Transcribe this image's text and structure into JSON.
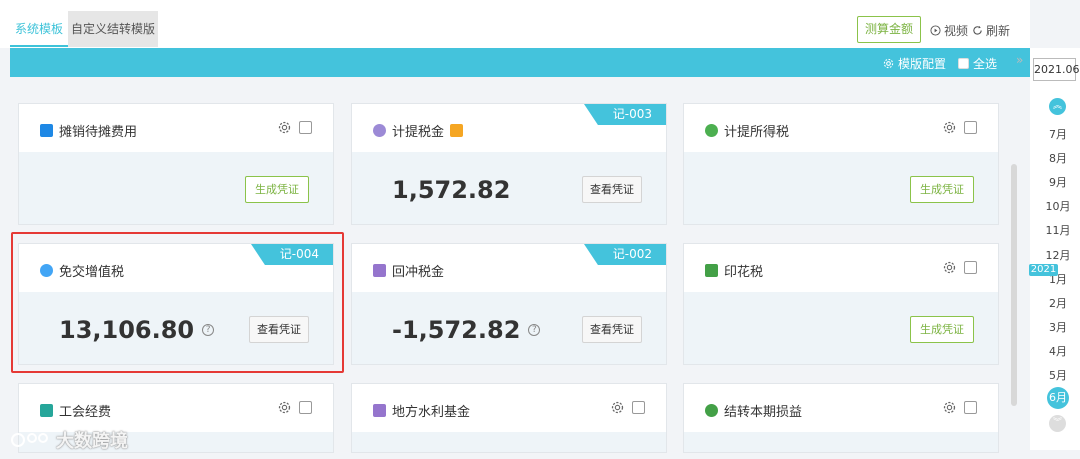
{
  "tabs": [
    {
      "label": "系统模板"
    },
    {
      "label": "自定义结转模版"
    }
  ],
  "toolbar": {
    "calc_label": "测算金额",
    "video_label": "视频",
    "refresh_label": "刷新",
    "config_label": "模版配置",
    "select_all_label": "全选"
  },
  "cards": [
    {
      "title": "摊销待摊费用",
      "action": "生成凭证",
      "icon": "windows-grid-icon"
    },
    {
      "title": "计提税金",
      "amount": "1,572.82",
      "action": "查看凭证",
      "badge": "记-003",
      "icon": "coin-stack-icon"
    },
    {
      "title": "计提所得税",
      "action": "生成凭证",
      "icon": "coin-stack-icon"
    },
    {
      "title": "免交增值税",
      "amount": "13,106.80",
      "action": "查看凭证",
      "badge": "记-004",
      "icon": "no-entry-icon"
    },
    {
      "title": "回冲税金",
      "amount": "-1,572.82",
      "action": "查看凭证",
      "badge": "记-002",
      "icon": "ticket-icon"
    },
    {
      "title": "印花税",
      "action": "生成凭证",
      "icon": "stamp-icon"
    },
    {
      "title": "工会经费",
      "icon": "house-icon"
    },
    {
      "title": "地方水利基金",
      "icon": "notebook-icon"
    },
    {
      "title": "结转本期损益",
      "icon": "money-bag-icon"
    }
  ],
  "calendar": {
    "current": "2021.06",
    "months": [
      "7月",
      "8月",
      "9月",
      "10月",
      "11月",
      "12月",
      "1月",
      "2月",
      "3月",
      "4月",
      "5月"
    ],
    "year_tag": "2021",
    "selected": "6月"
  },
  "watermark": "大数跨境",
  "colors": {
    "accent": "#44c3dc",
    "green": "#8bc34a",
    "highlight": "#e53935"
  }
}
